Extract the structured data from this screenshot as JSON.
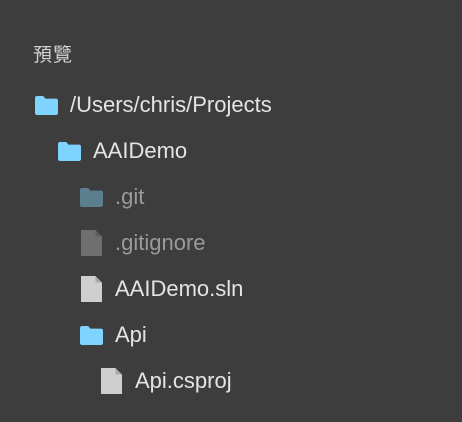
{
  "panel": {
    "heading": "預覽"
  },
  "tree": [
    {
      "label": "/Users/chris/Projects",
      "kind": "folder",
      "color": "#7fd3ff",
      "dim": false
    },
    {
      "label": "AAIDemo",
      "kind": "folder",
      "color": "#7fd3ff",
      "dim": false
    },
    {
      "label": ".git",
      "kind": "folder",
      "color": "#5c7f8f",
      "dim": true
    },
    {
      "label": ".gitignore",
      "kind": "file",
      "color": "#6f6f6f",
      "dim": true
    },
    {
      "label": "AAIDemo.sln",
      "kind": "file",
      "color": "#cfcfcf",
      "dim": false
    },
    {
      "label": "Api",
      "kind": "folder",
      "color": "#7fd3ff",
      "dim": false
    },
    {
      "label": "Api.csproj",
      "kind": "file",
      "color": "#cfcfcf",
      "dim": false
    }
  ]
}
